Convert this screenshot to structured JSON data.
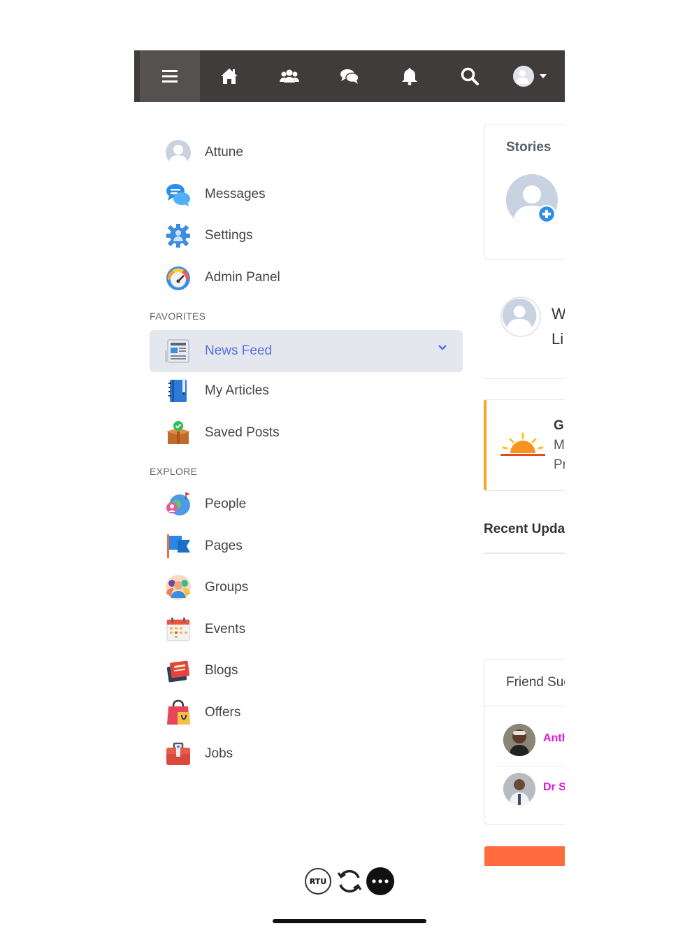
{
  "menu": {
    "items": [
      {
        "label": "Attune",
        "icon": "user-avatar-icon"
      },
      {
        "label": "Messages",
        "icon": "messages-icon"
      },
      {
        "label": "Settings",
        "icon": "settings-gear-icon"
      },
      {
        "label": "Admin Panel",
        "icon": "speedometer-icon"
      }
    ],
    "favorites_title": "FAVORITES",
    "favorites": [
      {
        "label": "News Feed",
        "icon": "newspaper-icon",
        "selected": true
      },
      {
        "label": "My Articles",
        "icon": "notebook-icon"
      },
      {
        "label": "Saved Posts",
        "icon": "saved-box-icon"
      }
    ],
    "explore_title": "EXPLORE",
    "explore": [
      {
        "label": "People",
        "icon": "people-globe-icon"
      },
      {
        "label": "Pages",
        "icon": "flag-icon"
      },
      {
        "label": "Groups",
        "icon": "group-icon"
      },
      {
        "label": "Events",
        "icon": "calendar-icon"
      },
      {
        "label": "Blogs",
        "icon": "books-icon"
      },
      {
        "label": "Offers",
        "icon": "shopping-bag-icon"
      },
      {
        "label": "Jobs",
        "icon": "briefcase-icon"
      }
    ]
  },
  "right": {
    "stories_title": "Stories",
    "post_line1": "W",
    "post_line2": "Li",
    "greeting_title": "G",
    "greeting_line1": "M",
    "greeting_line2": "Pr",
    "recent_updates": "Recent Updat",
    "friend_sugg": "Friend Sug",
    "friend1": "Anth",
    "friend2": "Dr S"
  },
  "bottom": {
    "rtu_label": "RTU"
  },
  "colors": {
    "accent": "#5b6fe6",
    "topbar": "#403c3b",
    "friend_name": "#e617d6",
    "orange_bar": "#ff6b3d"
  }
}
